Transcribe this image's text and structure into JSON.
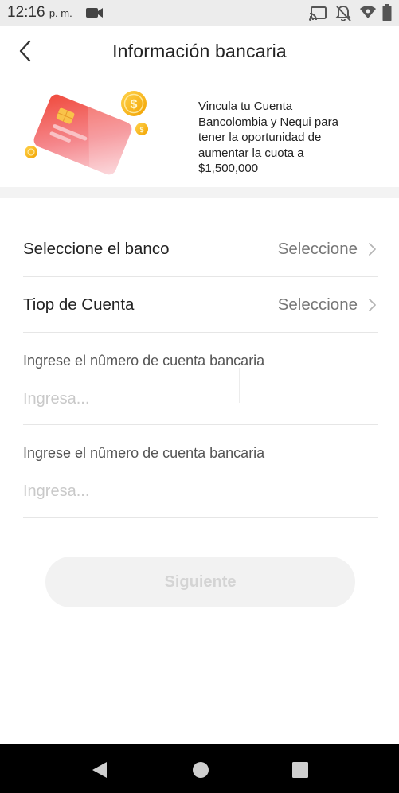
{
  "status_bar": {
    "time": "12:16",
    "ampm": "p. m.",
    "icons": [
      "video-camera-icon",
      "cast-icon",
      "notifications-off-icon",
      "wifi-icon",
      "battery-icon"
    ]
  },
  "header": {
    "title": "Información bancaria",
    "back_icon": "chevron-left-icon"
  },
  "banner": {
    "text": "Vincula tu Cuenta Bancolombia y Nequi para tener la oportunidad de aumentar la cuota a $1,500,000",
    "art": "credit-card-with-coins-illustration"
  },
  "form": {
    "bank_row": {
      "label": "Seleccione el banco",
      "value": "Seleccione"
    },
    "account_type_row": {
      "label": "Tiop de Cuenta",
      "value": "Seleccione"
    },
    "account_number_1": {
      "label": "Ingrese el nûmero de cuenta bancaria",
      "placeholder": "Ingresa...",
      "value": ""
    },
    "account_number_2": {
      "label": "Ingrese el nûmero de cuenta bancaria",
      "placeholder": "Ingresa...",
      "value": ""
    }
  },
  "actions": {
    "next_label": "Siguiente",
    "next_enabled": false
  },
  "nav_bar": {
    "buttons": [
      "back-triangle-icon",
      "home-circle-icon",
      "recents-square-icon"
    ]
  },
  "colors": {
    "accent_coin": "#f7b500",
    "card_red": "#f15a4a",
    "card_pink": "#f8a0a8",
    "disabled_button_bg": "#f2f2f2",
    "disabled_button_text": "#d4d4d4"
  }
}
